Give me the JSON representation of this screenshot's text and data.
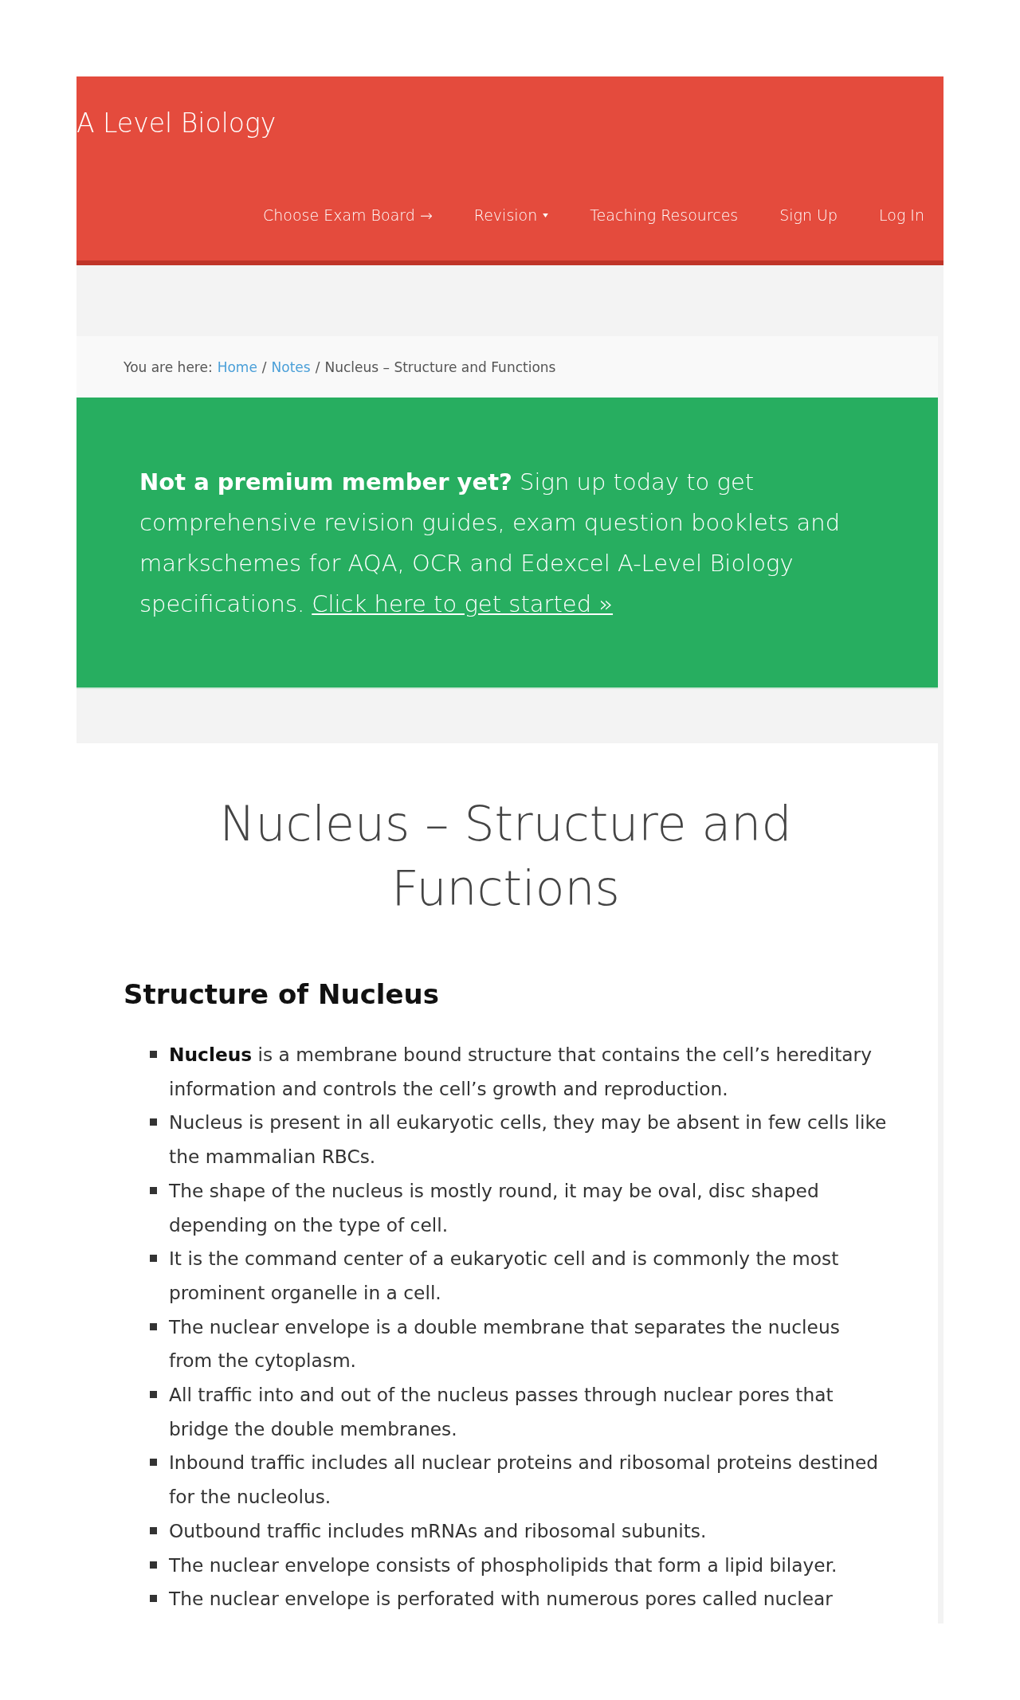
{
  "site": {
    "title": "A Level Biology"
  },
  "nav": [
    {
      "label": "Choose Exam Board →",
      "dropdown": false
    },
    {
      "label": "Revision",
      "dropdown": true
    },
    {
      "label": "Teaching Resources",
      "dropdown": false
    },
    {
      "label": "Sign Up",
      "dropdown": false
    },
    {
      "label": "Log In",
      "dropdown": false
    }
  ],
  "breadcrumb": {
    "prefix": "You are here:",
    "parts": [
      {
        "kind": "link",
        "text": "Home"
      },
      {
        "kind": "separator",
        "text": "/"
      },
      {
        "kind": "link",
        "text": "Notes"
      },
      {
        "kind": "separator",
        "text": "/"
      },
      {
        "kind": "current",
        "text": "Nucleus – Structure and Functions"
      }
    ]
  },
  "promo": {
    "text": "**Not a premium member yet?** Sign up today to get comprehensive revision guides, exam question booklets and markschemes for AQA, OCR and Edexcel A-Level Biology specifications.",
    "link": "Click here to get started »"
  },
  "article": {
    "title": "Nucleus – Structure and Functions",
    "sections": [
      {
        "heading": "Structure of Nucleus",
        "bullets": [
          "**Nucleus** is a membrane bound structure that contains the cell’s hereditary information and controls the cell’s growth and reproduction.",
          "Nucleus is present in all eukaryotic cells, they may be absent in few cells like the mammalian RBCs.",
          "The shape of the nucleus is mostly round, it may be oval, disc shaped depending on the type of cell.",
          "It is the command center of a eukaryotic cell and is commonly the most prominent organelle in a cell.",
          "The nuclear envelope is a double membrane that separates the nucleus from the cytoplasm.",
          "All traffic into and out of the nucleus passes through nuclear pores that bridge the double membranes.",
          "Inbound traffic includes all nuclear proteins and ribosomal proteins destined for the nucleolus.",
          "Outbound traffic includes mRNAs and ribosomal subunits.",
          "The nuclear envelope consists of phospholipids that form a lipid bilayer.",
          "The nuclear envelope is perforated with numerous pores called nuclear"
        ]
      }
    ]
  }
}
